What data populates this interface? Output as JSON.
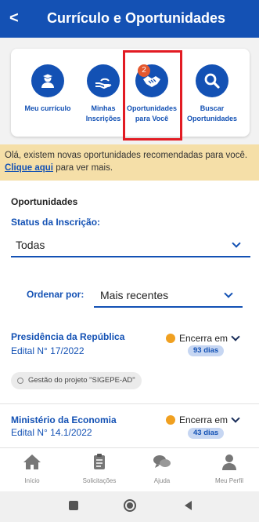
{
  "header": {
    "back_glyph": "<",
    "title": "Currículo e Oportunidades"
  },
  "quick_actions": [
    {
      "icon": "graduate-icon",
      "label_line1": "Meu currículo",
      "label_line2": ""
    },
    {
      "icon": "hand-icon",
      "label_line1": "Minhas",
      "label_line2": "Inscrições"
    },
    {
      "icon": "handshake-icon",
      "label_line1": "Oportunidades",
      "label_line2": "para Você",
      "badge": "2"
    },
    {
      "icon": "search-icon",
      "label_line1": "Buscar",
      "label_line2": "Oportunidades"
    }
  ],
  "notice": {
    "text": "Olá, existem novas oportunidades recomendadas para você.",
    "link": "Clique aqui",
    "suffix": "para ver mais."
  },
  "opportunities": {
    "section_title": "Oportunidades",
    "status_label": "Status da Inscrição:",
    "status_value": "Todas",
    "order_label": "Ordenar por:",
    "order_value": "Mais recentes",
    "items": [
      {
        "title": "Presidência da República",
        "edital": "Edital N° 17/2022",
        "closing_label": "Encerra em",
        "days": "93 dias",
        "chip": "Gestão do projeto \"SIGEPE-AD\""
      },
      {
        "title": "Ministério da Economia",
        "edital": "Edital N° 14.1/2022",
        "closing_label": "Encerra em",
        "days": "43 dias"
      }
    ]
  },
  "bottom_nav": [
    {
      "icon": "home-icon",
      "label": "Início"
    },
    {
      "icon": "clipboard-icon",
      "label": "Solicitações"
    },
    {
      "icon": "chat-icon",
      "label": "Ajuda"
    },
    {
      "icon": "profile-icon",
      "label": "Meu Perfil"
    }
  ],
  "colors": {
    "primary": "#1351b4",
    "notice_bg": "#f5dfa8",
    "highlight": "#e21b23",
    "badge": "#e4572e"
  }
}
